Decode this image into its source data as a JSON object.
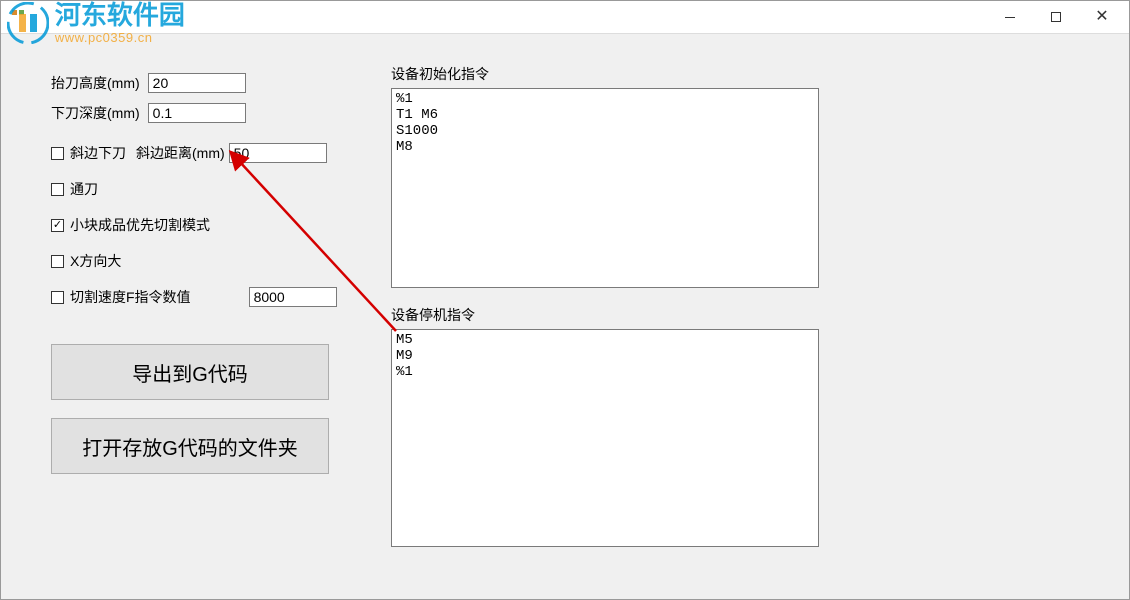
{
  "watermark": {
    "title": "河东软件园",
    "url": "www.pc0359.cn"
  },
  "leftPanel": {
    "liftHeightLabel": "抬刀高度(mm)",
    "liftHeightValue": "20",
    "cutDepthLabel": "下刀深度(mm)",
    "cutDepthValue": "0.1",
    "bevelCutLabel": "斜边下刀",
    "bevelDistLabel": "斜边距离(mm)",
    "bevelDistValue": "50",
    "throughCutLabel": "通刀",
    "smallPiecePriorityLabel": "小块成品优先切割模式",
    "xDirectionLabel": "X方向大",
    "speedCmdLabel": "切割速度F指令数值",
    "speedCmdValue": "8000"
  },
  "buttons": {
    "exportGCode": "导出到G代码",
    "openGCodeFolder": "打开存放G代码的文件夹"
  },
  "rightPanel": {
    "initLabel": "设备初始化指令",
    "initCmds": "%1\nT1 M6\nS1000\nM8",
    "stopLabel": "设备停机指令",
    "stopCmds": "M5\nM9\n%1"
  }
}
